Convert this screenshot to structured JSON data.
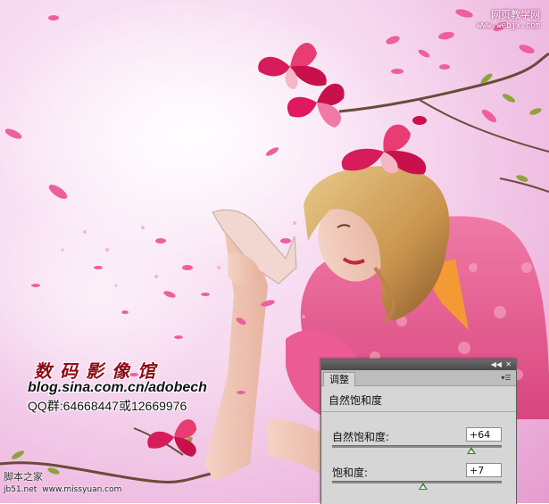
{
  "watermark_site": {
    "name": "网页教学网",
    "url": "www.webjx.com"
  },
  "studio": {
    "name": "数码影像馆",
    "blog": "blog.sina.com.cn/adobech",
    "qq": "QQ群:64668447或12669976"
  },
  "watermark_bottom": {
    "name": "脚本之家",
    "line2_a": "jb51.net",
    "line2_b": "www.missyuan.com"
  },
  "panel": {
    "tab_label": "调整",
    "collapse_icon": "double-arrow",
    "close_icon": "x",
    "heading": "自然饱和度",
    "vibrance_label": "自然饱和度:",
    "vibrance_value": "+64",
    "vibrance_level": 64,
    "saturation_label": "饱和度:",
    "saturation_value": "+7",
    "saturation_level": 7
  },
  "colors": {
    "accent_pink": "#e0177a",
    "petal": "#f06aa6",
    "studio_red": "#8b0d18"
  }
}
